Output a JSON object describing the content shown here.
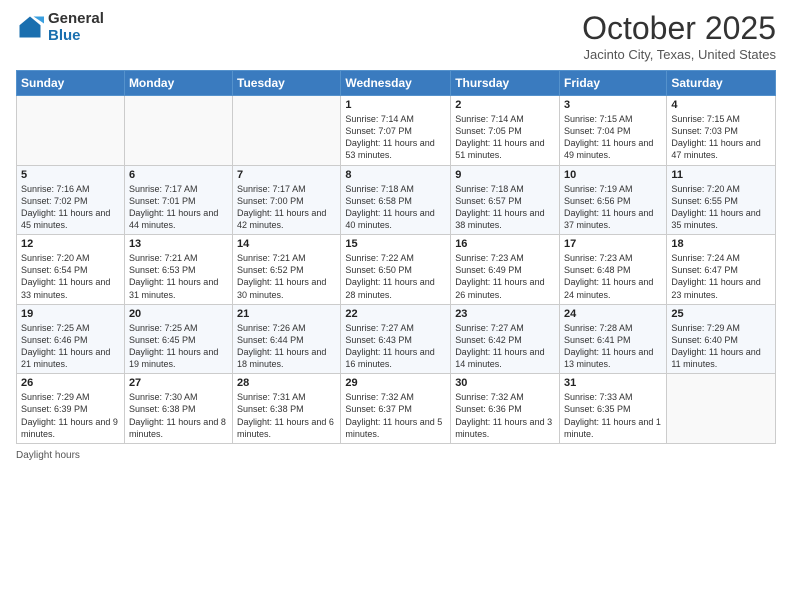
{
  "header": {
    "logo_general": "General",
    "logo_blue": "Blue",
    "month_title": "October 2025",
    "location": "Jacinto City, Texas, United States"
  },
  "weekdays": [
    "Sunday",
    "Monday",
    "Tuesday",
    "Wednesday",
    "Thursday",
    "Friday",
    "Saturday"
  ],
  "weeks": [
    [
      {
        "day": "",
        "info": ""
      },
      {
        "day": "",
        "info": ""
      },
      {
        "day": "",
        "info": ""
      },
      {
        "day": "1",
        "info": "Sunrise: 7:14 AM\nSunset: 7:07 PM\nDaylight: 11 hours and 53 minutes."
      },
      {
        "day": "2",
        "info": "Sunrise: 7:14 AM\nSunset: 7:05 PM\nDaylight: 11 hours and 51 minutes."
      },
      {
        "day": "3",
        "info": "Sunrise: 7:15 AM\nSunset: 7:04 PM\nDaylight: 11 hours and 49 minutes."
      },
      {
        "day": "4",
        "info": "Sunrise: 7:15 AM\nSunset: 7:03 PM\nDaylight: 11 hours and 47 minutes."
      }
    ],
    [
      {
        "day": "5",
        "info": "Sunrise: 7:16 AM\nSunset: 7:02 PM\nDaylight: 11 hours and 45 minutes."
      },
      {
        "day": "6",
        "info": "Sunrise: 7:17 AM\nSunset: 7:01 PM\nDaylight: 11 hours and 44 minutes."
      },
      {
        "day": "7",
        "info": "Sunrise: 7:17 AM\nSunset: 7:00 PM\nDaylight: 11 hours and 42 minutes."
      },
      {
        "day": "8",
        "info": "Sunrise: 7:18 AM\nSunset: 6:58 PM\nDaylight: 11 hours and 40 minutes."
      },
      {
        "day": "9",
        "info": "Sunrise: 7:18 AM\nSunset: 6:57 PM\nDaylight: 11 hours and 38 minutes."
      },
      {
        "day": "10",
        "info": "Sunrise: 7:19 AM\nSunset: 6:56 PM\nDaylight: 11 hours and 37 minutes."
      },
      {
        "day": "11",
        "info": "Sunrise: 7:20 AM\nSunset: 6:55 PM\nDaylight: 11 hours and 35 minutes."
      }
    ],
    [
      {
        "day": "12",
        "info": "Sunrise: 7:20 AM\nSunset: 6:54 PM\nDaylight: 11 hours and 33 minutes."
      },
      {
        "day": "13",
        "info": "Sunrise: 7:21 AM\nSunset: 6:53 PM\nDaylight: 11 hours and 31 minutes."
      },
      {
        "day": "14",
        "info": "Sunrise: 7:21 AM\nSunset: 6:52 PM\nDaylight: 11 hours and 30 minutes."
      },
      {
        "day": "15",
        "info": "Sunrise: 7:22 AM\nSunset: 6:50 PM\nDaylight: 11 hours and 28 minutes."
      },
      {
        "day": "16",
        "info": "Sunrise: 7:23 AM\nSunset: 6:49 PM\nDaylight: 11 hours and 26 minutes."
      },
      {
        "day": "17",
        "info": "Sunrise: 7:23 AM\nSunset: 6:48 PM\nDaylight: 11 hours and 24 minutes."
      },
      {
        "day": "18",
        "info": "Sunrise: 7:24 AM\nSunset: 6:47 PM\nDaylight: 11 hours and 23 minutes."
      }
    ],
    [
      {
        "day": "19",
        "info": "Sunrise: 7:25 AM\nSunset: 6:46 PM\nDaylight: 11 hours and 21 minutes."
      },
      {
        "day": "20",
        "info": "Sunrise: 7:25 AM\nSunset: 6:45 PM\nDaylight: 11 hours and 19 minutes."
      },
      {
        "day": "21",
        "info": "Sunrise: 7:26 AM\nSunset: 6:44 PM\nDaylight: 11 hours and 18 minutes."
      },
      {
        "day": "22",
        "info": "Sunrise: 7:27 AM\nSunset: 6:43 PM\nDaylight: 11 hours and 16 minutes."
      },
      {
        "day": "23",
        "info": "Sunrise: 7:27 AM\nSunset: 6:42 PM\nDaylight: 11 hours and 14 minutes."
      },
      {
        "day": "24",
        "info": "Sunrise: 7:28 AM\nSunset: 6:41 PM\nDaylight: 11 hours and 13 minutes."
      },
      {
        "day": "25",
        "info": "Sunrise: 7:29 AM\nSunset: 6:40 PM\nDaylight: 11 hours and 11 minutes."
      }
    ],
    [
      {
        "day": "26",
        "info": "Sunrise: 7:29 AM\nSunset: 6:39 PM\nDaylight: 11 hours and 9 minutes."
      },
      {
        "day": "27",
        "info": "Sunrise: 7:30 AM\nSunset: 6:38 PM\nDaylight: 11 hours and 8 minutes."
      },
      {
        "day": "28",
        "info": "Sunrise: 7:31 AM\nSunset: 6:38 PM\nDaylight: 11 hours and 6 minutes."
      },
      {
        "day": "29",
        "info": "Sunrise: 7:32 AM\nSunset: 6:37 PM\nDaylight: 11 hours and 5 minutes."
      },
      {
        "day": "30",
        "info": "Sunrise: 7:32 AM\nSunset: 6:36 PM\nDaylight: 11 hours and 3 minutes."
      },
      {
        "day": "31",
        "info": "Sunrise: 7:33 AM\nSunset: 6:35 PM\nDaylight: 11 hours and 1 minute."
      },
      {
        "day": "",
        "info": ""
      }
    ]
  ],
  "footer": {
    "daylight_hours": "Daylight hours"
  }
}
